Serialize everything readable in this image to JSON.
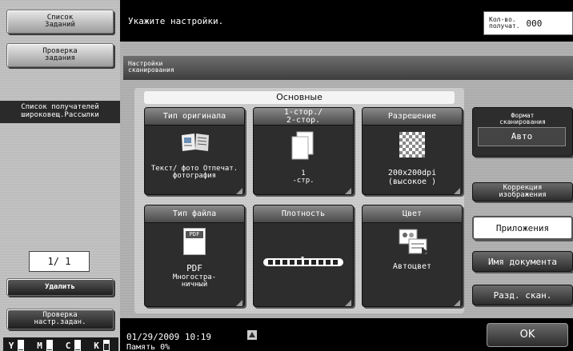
{
  "left": {
    "job_list": "Список\nЗаданий",
    "check_job": "Проверка\nзадания",
    "broadcast_list": "Список получателей\nшироковещ.Рассылки",
    "page_indicator": "1/ 1",
    "delete_button": "Удалить",
    "check_job_settings": "Проверка\nнастр.задан.",
    "toner": [
      {
        "letter": "Y",
        "level": 0.05
      },
      {
        "letter": "M",
        "level": 0.05
      },
      {
        "letter": "C",
        "level": 0.05
      },
      {
        "letter": "K",
        "level": 0.7
      }
    ]
  },
  "header": {
    "instruction": "Укажите настройки.",
    "copies_label": "Кол-во.\nполучат.",
    "copies_value": "000"
  },
  "panel": {
    "title": "Настройки\nсканирования",
    "group_tab": "Основные",
    "tiles": {
      "original_type": {
        "label": "Тип оригинала",
        "value": "Текст/\nфото\nОтпечат.\nфотография"
      },
      "duplex": {
        "label": "1-стор./\n2-стор.",
        "value": "1\n-стр."
      },
      "resolution": {
        "label": "Разрешение",
        "value": "200x200dpi\n(высокое )"
      },
      "file_type": {
        "label": "Тип файла",
        "value": "PDF",
        "sub": "Многостра-\nничный",
        "icon_text": "PDF"
      },
      "density": {
        "label": "Плотность"
      },
      "color": {
        "label": "Цвет",
        "value": "Автоцвет"
      }
    },
    "scan_format": {
      "label": "Формат\nсканирования",
      "value": "Авто"
    },
    "image_correction": "Коррекция\nизображения",
    "applications": "Приложения",
    "document_name": "Имя документа",
    "separate_scan": "Разд. скан."
  },
  "footer": {
    "datetime": "01/29/2009   10:19",
    "memory": "Память        0%",
    "ok": "OK"
  }
}
